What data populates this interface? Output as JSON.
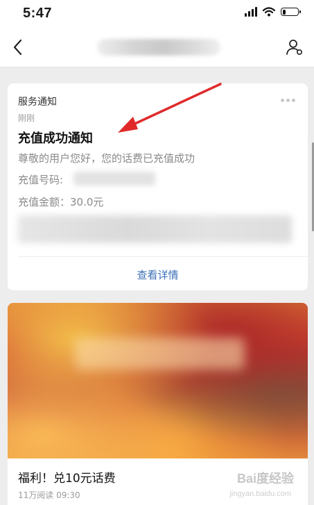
{
  "status_bar": {
    "time": "5:47",
    "battery_level": 0.2
  },
  "nav": {
    "back_icon": "chevron-left-icon",
    "profile_icon": "user-settings-icon"
  },
  "card": {
    "service_name": "服务通知",
    "time": "刚刚",
    "title": "充值成功通知",
    "description": "尊敬的用户您好，您的话费已充值成功",
    "field_number_label": "充值号码:",
    "field_amount": "充值金额：30.0元",
    "details_link": "查看详情"
  },
  "article": {
    "title": "福利！兑10元话费",
    "meta": "11万阅读 09:30",
    "watermark": "Bai度经验",
    "watermark_sub": "jingyan.baidu.com"
  },
  "colors": {
    "link": "#3a6fb8",
    "annotation_arrow": "#e02a2a",
    "background": "#ededed"
  }
}
